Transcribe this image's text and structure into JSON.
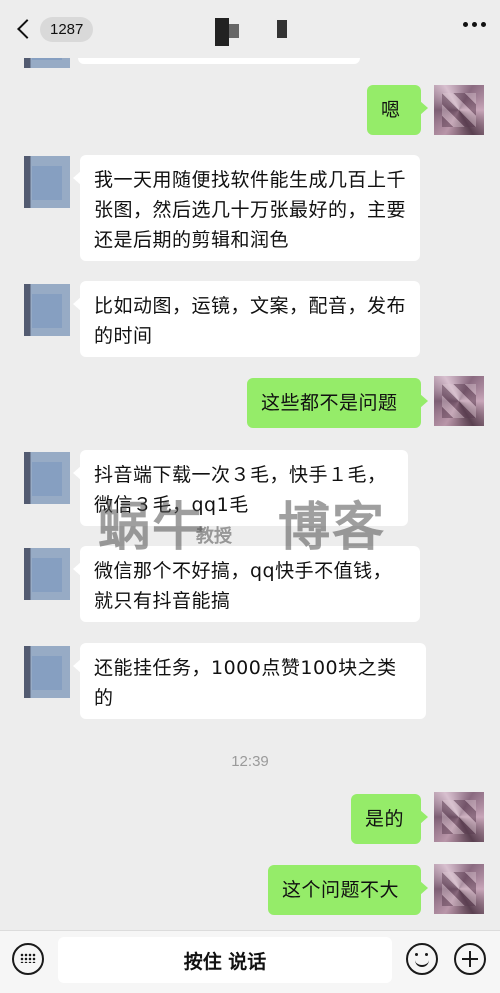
{
  "header": {
    "unread_count": "1287"
  },
  "messages": [
    {
      "side": "right",
      "text": "嗯"
    },
    {
      "side": "left",
      "text": "我一天用随便找软件能生成几百上千张图，然后选几十万张最好的，主要还是后期的剪辑和润色"
    },
    {
      "side": "left",
      "text": "比如动图，运镜，文案，配音，发布的时间"
    },
    {
      "side": "right",
      "text": "这些都不是问题"
    },
    {
      "side": "left",
      "text": "抖音端下载一次３毛，快手１毛，微信３毛，qq1毛"
    },
    {
      "side": "left",
      "text": "微信那个不好搞，qq快手不值钱，就只有抖音能搞"
    },
    {
      "side": "left",
      "text": "还能挂任务，1000点赞100块之类的"
    },
    {
      "side": "right",
      "text": "是的"
    },
    {
      "side": "right",
      "text": "这个问题不大"
    }
  ],
  "timestamp": "12:39",
  "watermark": {
    "main_left": "蜗牛",
    "main_small": "教授",
    "main_right": "博客"
  },
  "bottom": {
    "hold_to_talk": "按住 说话"
  }
}
